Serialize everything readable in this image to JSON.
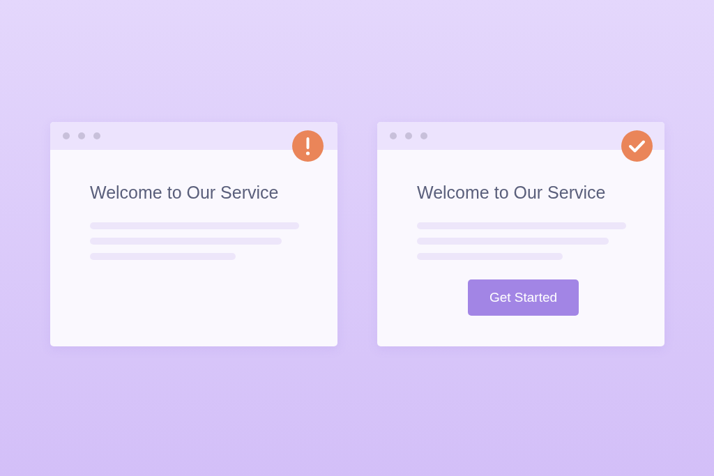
{
  "windows": [
    {
      "kind": "warning",
      "title": "Welcome to Our Service"
    },
    {
      "kind": "success",
      "title": "Welcome to Our Service",
      "button": "Get Started"
    }
  ]
}
